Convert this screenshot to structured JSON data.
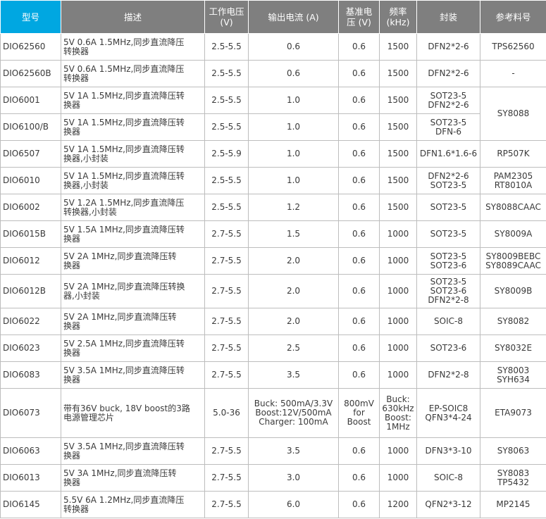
{
  "header": {
    "model": "型号",
    "desc": "描述",
    "voltage": "工作电压\n(V)",
    "current": "输出电流 (A)",
    "vref": "基准电\n压 (V)",
    "freq": "频率\n(kHz)",
    "package": "封装",
    "ref": "参考料号"
  },
  "rows": [
    {
      "model": "DIO62560",
      "desc": "5V 0.6A 1.5MHz,同步直流降压\n转换器",
      "voltage": "2.5-5.5",
      "current": "0.6",
      "vref": "0.6",
      "freq": "1500",
      "package": "DFN2*2-6",
      "ref": "TPS62560"
    },
    {
      "model": "DIO62560B",
      "desc": "5V 0.6A 1.5MHz,同步直流降压\n转换器",
      "voltage": "2.5-5.5",
      "current": "0.6",
      "vref": "0.6",
      "freq": "1500",
      "package": "DFN2*2-6",
      "ref": "-"
    },
    {
      "model": "DIO6001",
      "desc": "5V 1A 1.5MHz,同步直流降压转\n换器",
      "voltage": "2.5-5.5",
      "current": "1.0",
      "vref": "0.6",
      "freq": "1500",
      "package": "SOT23-5\nDFN2*2-6",
      "ref": "SY8088"
    },
    {
      "model": "DIO6100/B",
      "desc": "5V 1A 1.5MHz,同步直流降压转\n换器",
      "voltage": "2.5-5.5",
      "current": "1.0",
      "vref": "0.6",
      "freq": "1500",
      "package": "SOT23-5\nDFN-6",
      "ref": ""
    },
    {
      "model": "DIO6507",
      "desc": "5V 1A 1.5MHz,同步直流降压转\n换器,小封装",
      "voltage": "2.5-5.9",
      "current": "1.0",
      "vref": "0.6",
      "freq": "1500",
      "package": "DFN1.6*1.6-6",
      "ref": "RP507K"
    },
    {
      "model": "DIO6010",
      "desc": "5V 1A 1.5MHz,同步直流降压转\n换器,小封装",
      "voltage": "2.5-5.5",
      "current": "1.0",
      "vref": "0.6",
      "freq": "1500",
      "package": "DFN2*2-6\nSOT23-5",
      "ref": "PAM2305\nRT8010A"
    },
    {
      "model": "DIO6002",
      "desc": "5V 1.2A 1.5MHz,同步直流降压\n转换器,小封装",
      "voltage": "2.5-5.5",
      "current": "1.2",
      "vref": "0.6",
      "freq": "1500",
      "package": "SOT23-5",
      "ref": "SY8088CAAC"
    },
    {
      "model": "DIO6015B",
      "desc": "5V 1.5A 1MHz,同步直流降压转\n换器",
      "voltage": "2.7-5.5",
      "current": "1.5",
      "vref": "0.6",
      "freq": "1000",
      "package": "SOT23-5",
      "ref": "SY8009A"
    },
    {
      "model": "DIO6012",
      "desc": "5V 2A 1MHz,同步直流降压转\n换器",
      "voltage": "2.7-5.5",
      "current": "2.0",
      "vref": "0.6",
      "freq": "1000",
      "package": "SOT23-5\nSOT23-6",
      "ref": "SY8009BEBC\nSY8089CAAC"
    },
    {
      "model": "DIO6012B",
      "desc": "5V 2A 1MHz,同步直流降压转换\n器,小封装",
      "voltage": "2.7-5.5",
      "current": "2.0",
      "vref": "0.6",
      "freq": "1000",
      "package": "SOT23-5\nSOT23-6\nDFN2*2-8",
      "ref": "SY8009B"
    },
    {
      "model": "DIO6022",
      "desc": "5V 2A 1MHz,同步直流降压转\n换器",
      "voltage": "2.7-5.5",
      "current": "2.0",
      "vref": "0.6",
      "freq": "1000",
      "package": "SOIC-8",
      "ref": "SY8082"
    },
    {
      "model": "DIO6023",
      "desc": "5V 2.5A 1MHz,同步直流降压转\n换器",
      "voltage": "2.7-5.5",
      "current": "2.5",
      "vref": "0.6",
      "freq": "1000",
      "package": "SOT23-6",
      "ref": "SY8032E"
    },
    {
      "model": "DIO6083",
      "desc": "5V 3.5A 1MHz,同步直流降压转\n换器",
      "voltage": "2.7-5.5",
      "current": "3.5",
      "vref": "0.6",
      "freq": "1000",
      "package": "DFN2*2-8",
      "ref": "SY8003\nSYH634"
    },
    {
      "model": "DIO6073",
      "desc": "带有36V buck, 18V boost的3路\n电源管理芯片",
      "voltage": "5.0-36",
      "current": "Buck: 500mA/3.3V\nBoost:12V/500mA\nCharger: 100mA",
      "vref": "800mV\nfor\nBoost",
      "freq": "Buck:\n630kHz\nBoost:\n1MHz",
      "package": "EP-SOIC8\nQFN3*4-24",
      "ref": "ETA9073"
    },
    {
      "model": "DIO6063",
      "desc": "5V 3.5A 1MHz,同步直流降压转\n换器",
      "voltage": "2.7-5.5",
      "current": "3.5",
      "vref": "0.6",
      "freq": "1000",
      "package": "DFN3*3-10",
      "ref": "SY8063"
    },
    {
      "model": "DIO6013",
      "desc": "5V 3A 1MHz,同步直流降压转\n换器",
      "voltage": "2.7-5.5",
      "current": "3.0",
      "vref": "0.6",
      "freq": "1000",
      "package": "SOIC-8",
      "ref": "SY8083\nTP5432"
    },
    {
      "model": "DIO6145",
      "desc": "5.5V 6A 1.2MHz,同步直流降压\n转换器",
      "voltage": "2.7-5.5",
      "current": "6.0",
      "vref": "0.6",
      "freq": "1200",
      "package": "QFN2*3-12",
      "ref": "MP2145"
    }
  ]
}
